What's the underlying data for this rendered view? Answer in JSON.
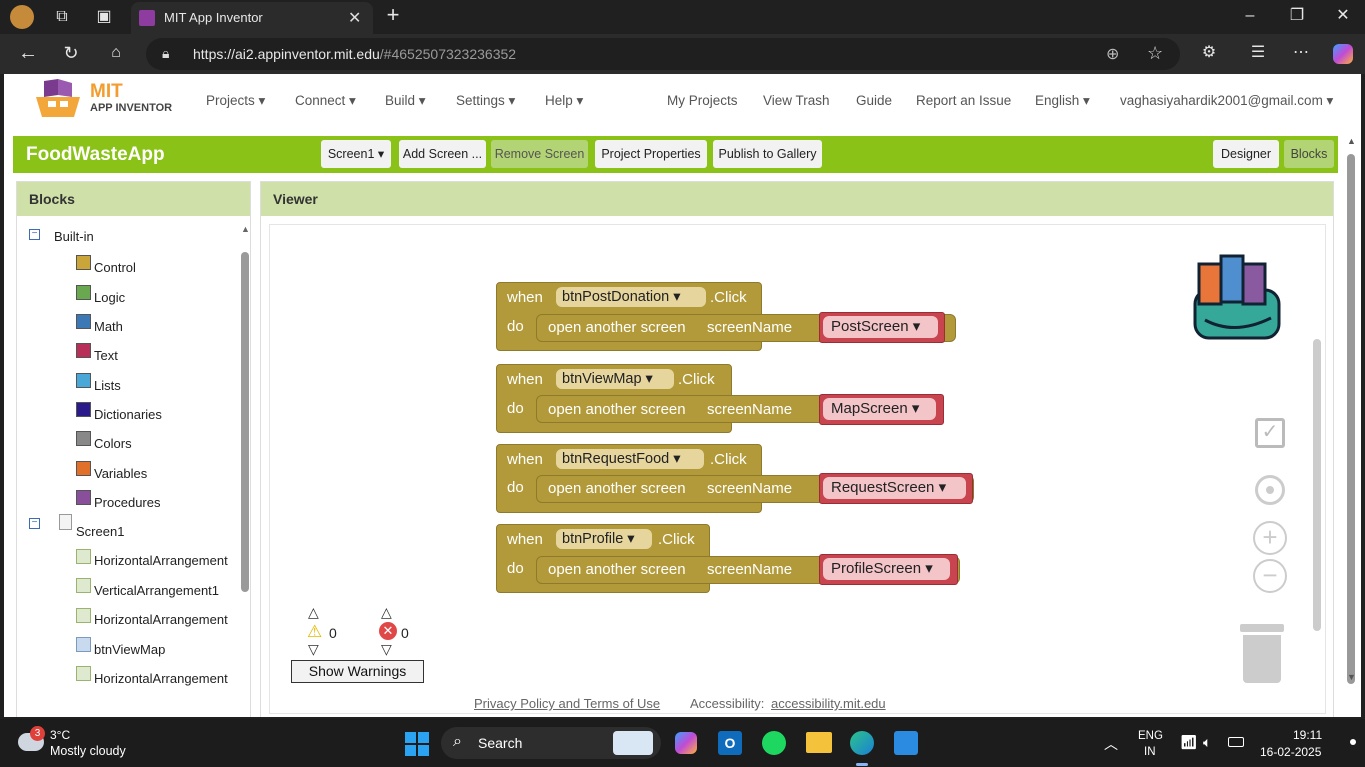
{
  "browser": {
    "tab_title": "MIT App Inventor",
    "url_host": "https://ai2.appinventor.mit.edu",
    "url_rest": "/#4652507323236352"
  },
  "header": {
    "logo_top": "MIT",
    "logo_bottom": "APP INVENTOR",
    "nav": [
      "Projects ▾",
      "Connect ▾",
      "Build ▾",
      "Settings ▾",
      "Help ▾"
    ],
    "right_links": [
      "My Projects",
      "View Trash",
      "Guide",
      "Report an Issue",
      "English ▾"
    ],
    "user": "vaghasiyahardik2001@gmail.com ▾"
  },
  "toolbar": {
    "project_name": "FoodWasteApp",
    "screen_select": "Screen1 ▾",
    "add_screen": "Add Screen ...",
    "remove_screen": "Remove Screen",
    "project_properties": "Project Properties",
    "publish": "Publish to Gallery",
    "designer": "Designer",
    "blocks": "Blocks"
  },
  "blocks_panel": {
    "title": "Blocks",
    "builtin": "Built-in",
    "builtin_items": [
      {
        "label": "Control",
        "color": "#c9a53a"
      },
      {
        "label": "Logic",
        "color": "#6aa84f"
      },
      {
        "label": "Math",
        "color": "#3c78b5"
      },
      {
        "label": "Text",
        "color": "#b8305a"
      },
      {
        "label": "Lists",
        "color": "#4aa8d8"
      },
      {
        "label": "Dictionaries",
        "color": "#2a1a8a"
      },
      {
        "label": "Colors",
        "color": "#888888"
      },
      {
        "label": "Variables",
        "color": "#e0702a"
      },
      {
        "label": "Procedures",
        "color": "#8a4f9a"
      }
    ],
    "screen": "Screen1",
    "components": [
      "HorizontalArrangement",
      "VerticalArrangement1",
      "HorizontalArrangement",
      "btnViewMap",
      "HorizontalArrangement"
    ]
  },
  "viewer": {
    "title": "Viewer",
    "when_word": "when",
    "do_word": "do",
    "open_text": "open another screen",
    "screen_name_word": "screenName",
    "click_word": ".Click",
    "blocks": [
      {
        "button": "btnPostDonation ▾",
        "screen": "PostScreen ▾"
      },
      {
        "button": "btnViewMap ▾",
        "screen": "MapScreen ▾"
      },
      {
        "button": "btnRequestFood ▾",
        "screen": "RequestScreen ▾"
      },
      {
        "button": "btnProfile ▾",
        "screen": "ProfileScreen ▾"
      }
    ],
    "warnings_count": "0",
    "errors_count": "0",
    "show_warnings": "Show Warnings"
  },
  "footer": {
    "privacy": "Privacy Policy and Terms of Use",
    "accessibility_label": "Accessibility:",
    "accessibility_link": "accessibility.mit.edu"
  },
  "taskbar": {
    "temp": "3°C",
    "weather": "Mostly cloudy",
    "badge": "3",
    "search": "Search",
    "lang1": "ENG",
    "lang2": "IN",
    "time": "19:11",
    "date": "16-02-2025"
  }
}
